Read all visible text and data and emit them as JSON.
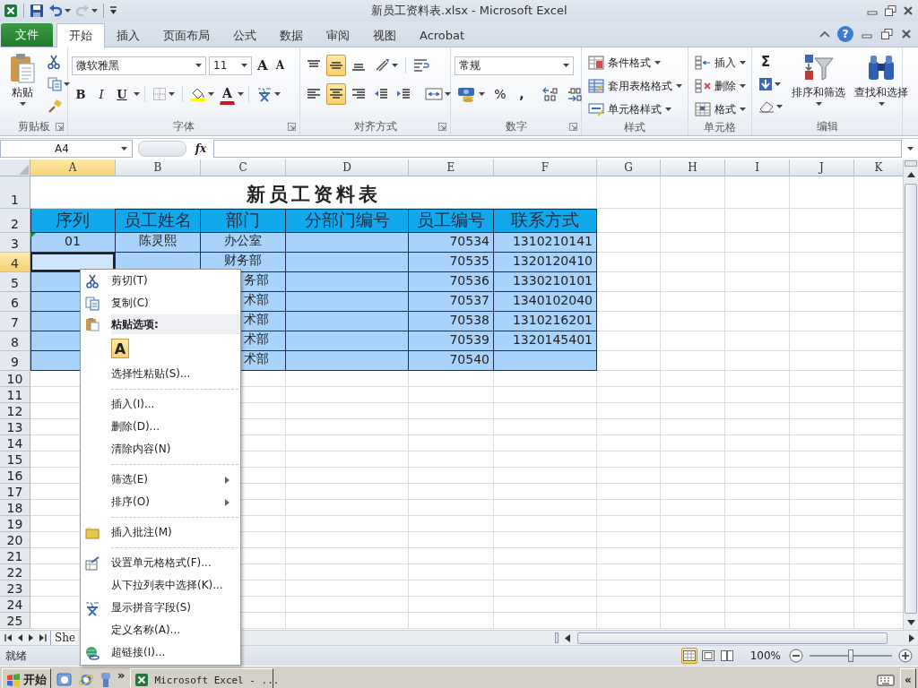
{
  "window": {
    "title": "新员工资料表.xlsx - Microsoft Excel"
  },
  "ribbon_tabs": [
    {
      "label": "文件",
      "kind": "file",
      "selected": false
    },
    {
      "label": "开始",
      "kind": "tab",
      "selected": true
    },
    {
      "label": "插入",
      "kind": "tab",
      "selected": false
    },
    {
      "label": "页面布局",
      "kind": "tab",
      "selected": false
    },
    {
      "label": "公式",
      "kind": "tab",
      "selected": false
    },
    {
      "label": "数据",
      "kind": "tab",
      "selected": false
    },
    {
      "label": "审阅",
      "kind": "tab",
      "selected": false
    },
    {
      "label": "视图",
      "kind": "tab",
      "selected": false
    },
    {
      "label": "Acrobat",
      "kind": "tab",
      "selected": false
    }
  ],
  "help": {
    "label": "?"
  },
  "ribbon": {
    "clipboard": {
      "paste": "粘贴",
      "label": "剪贴板"
    },
    "font": {
      "font_name": "微软雅黑",
      "font_size": "11",
      "grow": "A",
      "shrink": "A",
      "bold": "B",
      "italic": "I",
      "underline": "U",
      "font_color": "A",
      "label": "字体"
    },
    "alignment": {
      "vertical": [
        {
          "selected": false
        },
        {
          "selected": true
        },
        {
          "selected": false
        }
      ],
      "horizontal": [
        {
          "selected": false
        },
        {
          "selected": true
        },
        {
          "selected": false
        }
      ],
      "label": "对齐方式"
    },
    "number": {
      "format": "常规",
      "percent": "%",
      "comma": ",",
      "label": "数字"
    },
    "styles": {
      "buttons": [
        "条件格式",
        "套用表格格式",
        "单元格样式"
      ],
      "label": "样式"
    },
    "cells": {
      "buttons": [
        "插入",
        "删除",
        "格式"
      ],
      "label": "单元格"
    },
    "editing": {
      "sum": "Σ",
      "sort_filter": "排序和筛选",
      "find_select": "查找和选择",
      "label": "编辑"
    }
  },
  "formula_bar": {
    "name_box": "A4",
    "fx": "fx"
  },
  "sheet": {
    "columns": [
      {
        "label": "A",
        "selected": true
      },
      {
        "label": "B",
        "selected": false
      },
      {
        "label": "C",
        "selected": false
      },
      {
        "label": "D",
        "selected": false
      },
      {
        "label": "E",
        "selected": false
      },
      {
        "label": "F",
        "selected": false
      },
      {
        "label": "G",
        "selected": false
      },
      {
        "label": "H",
        "selected": false
      },
      {
        "label": "I",
        "selected": false
      },
      {
        "label": "J",
        "selected": false
      },
      {
        "label": "K",
        "selected": false
      }
    ],
    "rows": [
      {
        "label": "1",
        "selected": false
      },
      {
        "label": "2",
        "selected": false
      },
      {
        "label": "3",
        "selected": false
      },
      {
        "label": "4",
        "selected": true
      },
      {
        "label": "5",
        "selected": false
      },
      {
        "label": "6",
        "selected": false
      },
      {
        "label": "7",
        "selected": false
      },
      {
        "label": "8",
        "selected": false
      },
      {
        "label": "9",
        "selected": false
      },
      {
        "label": "10",
        "selected": false
      },
      {
        "label": "11",
        "selected": false
      },
      {
        "label": "12",
        "selected": false
      },
      {
        "label": "13",
        "selected": false
      },
      {
        "label": "14",
        "selected": false
      },
      {
        "label": "15",
        "selected": false
      },
      {
        "label": "16",
        "selected": false
      },
      {
        "label": "17",
        "selected": false
      },
      {
        "label": "18",
        "selected": false
      },
      {
        "label": "19",
        "selected": false
      },
      {
        "label": "20",
        "selected": false
      },
      {
        "label": "21",
        "selected": false
      },
      {
        "label": "22",
        "selected": false
      },
      {
        "label": "23",
        "selected": false
      },
      {
        "label": "24",
        "selected": false
      },
      {
        "label": "25",
        "selected": false
      }
    ],
    "table": {
      "title": "新员工资料表",
      "headers": [
        "序列",
        "员工姓名",
        "部门",
        "分部门编号",
        "员工编号",
        "联系方式"
      ],
      "records": [
        {
          "seq": "01",
          "name": "陈灵熙",
          "department": "办公室",
          "employee_no": "70534",
          "phone": "1310210141"
        },
        {
          "department": "财务部",
          "employee_no": "70535",
          "phone": "1320120410"
        },
        {
          "department": "务部",
          "employee_no": "70536",
          "phone": "1330210101"
        },
        {
          "department": "术部",
          "employee_no": "70537",
          "phone": "1340102040"
        },
        {
          "department": "术部",
          "employee_no": "70538",
          "phone": "1310216201"
        },
        {
          "department": "术部",
          "employee_no": "70539",
          "phone": "1320145401"
        },
        {
          "department": "术部",
          "employee_no": "70540"
        }
      ]
    }
  },
  "context_menu": {
    "items": [
      {
        "kind": "command",
        "label": "剪切(T)"
      },
      {
        "kind": "command",
        "label": "复制(C)"
      },
      {
        "kind": "header",
        "label": "粘贴选项:"
      },
      {
        "kind": "paste_option",
        "label": "A"
      },
      {
        "kind": "command",
        "label": "选择性粘贴(S)..."
      },
      {
        "kind": "separator"
      },
      {
        "kind": "command",
        "label": "插入(I)..."
      },
      {
        "kind": "command",
        "label": "删除(D)..."
      },
      {
        "kind": "command",
        "label": "清除内容(N)"
      },
      {
        "kind": "separator"
      },
      {
        "kind": "submenu",
        "label": "筛选(E)"
      },
      {
        "kind": "submenu",
        "label": "排序(O)"
      },
      {
        "kind": "separator"
      },
      {
        "kind": "command",
        "label": "插入批注(M)"
      },
      {
        "kind": "separator"
      },
      {
        "kind": "command",
        "label": "设置单元格格式(F)..."
      },
      {
        "kind": "command",
        "label": "从下拉列表中选择(K)..."
      },
      {
        "kind": "command",
        "label": "显示拼音字段(S)"
      },
      {
        "kind": "command",
        "label": "定义名称(A)..."
      },
      {
        "kind": "command",
        "label": "超链接(I)..."
      }
    ]
  },
  "sheet_tabs": [
    {
      "label": "She",
      "selected": true
    }
  ],
  "status_bar": {
    "text": "就绪",
    "views": [
      {
        "selected": true
      },
      {
        "selected": false
      },
      {
        "selected": false
      }
    ],
    "zoom": {
      "label": "100%",
      "level": 0.5
    }
  },
  "taskbar": {
    "start": "开始",
    "more": "»",
    "tasks": [
      {
        "label": "Microsoft Excel - ..."
      }
    ],
    "collapse": "«"
  }
}
